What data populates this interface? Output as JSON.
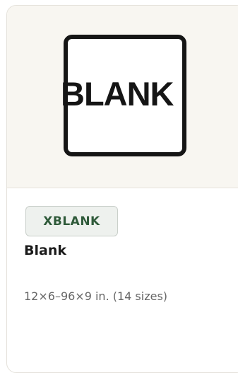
{
  "product": {
    "logo_text": "BLANK",
    "badge": "XBLANK",
    "name": "Blank",
    "sizes": "12×6–96×9 in. (14 sizes)"
  },
  "colors": {
    "thumbnail_bg": "#f8f6f1",
    "badge_bg": "#eef1ee",
    "badge_text": "#2f5a3a",
    "border": "#e4e1da"
  }
}
